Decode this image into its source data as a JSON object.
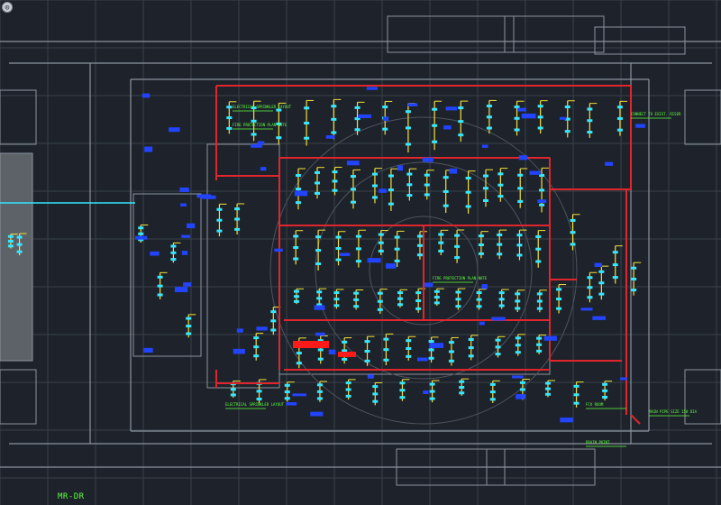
{
  "viewer": {
    "canvas_label": "",
    "corner_icon": "viewport-control-icon",
    "layout_tag": "MR-DR"
  },
  "colors": {
    "background": "#1e232b",
    "grid": "#39404a",
    "wall": "#8c939c",
    "fire_main": "#e0262c",
    "branch_yellow": "#f2e03a",
    "branch_cyan": "#35e6ff",
    "blue_tag": "#2244ff",
    "green_note": "#5cff3c",
    "red_marker": "#ff1a1a"
  },
  "annotations": [
    "ELECTRICAL SPRINKLER LAYOUT",
    "FIRE PROTECTION PLAN NOTE",
    "CONNECT TO EXIST. RISER",
    "MAIN PIPE SIZE 150 DIA",
    "FCV ROOM",
    "DRAIN POINT"
  ]
}
